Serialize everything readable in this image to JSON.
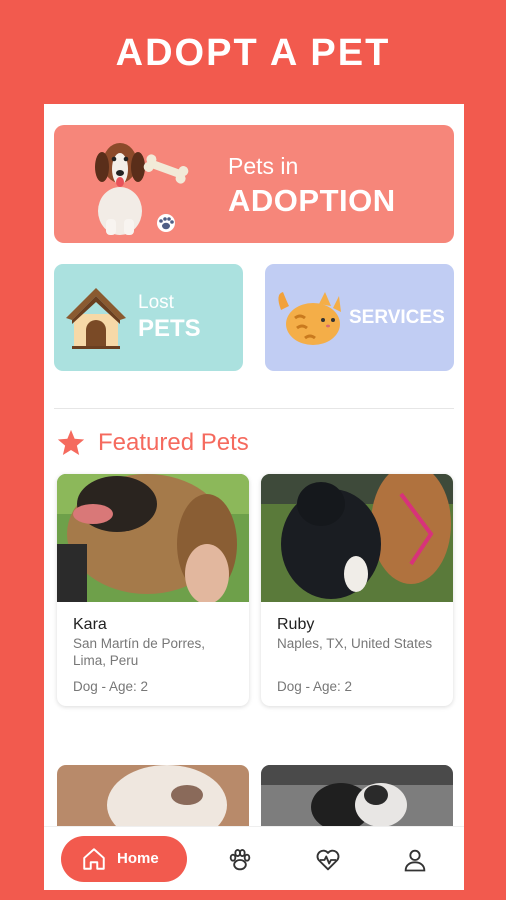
{
  "banner": {
    "title": "ADOPT A PET"
  },
  "categories": {
    "adoption": {
      "line1": "Pets in",
      "line2": "ADOPTION"
    },
    "lost": {
      "line1": "Lost",
      "line2": "PETS"
    },
    "services": {
      "label": "SERVICES"
    }
  },
  "featured": {
    "title": "Featured Pets",
    "pets": [
      {
        "name": "Kara",
        "location": "San Martín de Porres, Lima, Peru",
        "meta": "Dog - Age: 2"
      },
      {
        "name": "Ruby",
        "location": "Naples, TX, United States",
        "meta": "Dog - Age: 2"
      }
    ]
  },
  "nav": {
    "items": [
      {
        "label": "Home",
        "icon": "home-icon",
        "active": true
      },
      {
        "label": "",
        "icon": "paw-icon"
      },
      {
        "label": "",
        "icon": "health-icon"
      },
      {
        "label": "",
        "icon": "profile-icon"
      }
    ]
  },
  "colors": {
    "background": "#f25a4e",
    "adoption_card": "#f6867a",
    "lost_card": "#abe1df",
    "services_card": "#c1cdf3",
    "accent": "#f56a5e"
  }
}
